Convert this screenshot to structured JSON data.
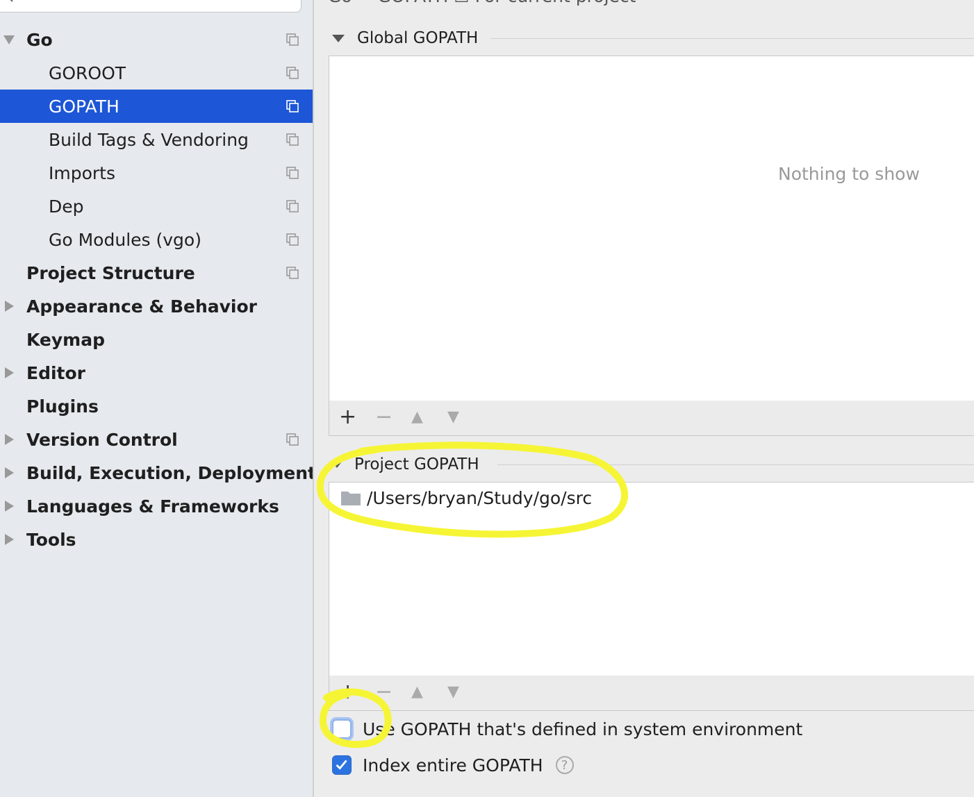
{
  "colors": {
    "selection": "#1d56d6",
    "highlight": "#f6f535",
    "checkbox_on": "#2b73e0"
  },
  "top_fragment": "Go  →  GOPATH        ☐ For current project",
  "sidebar": {
    "search_icon": "search-icon",
    "items": [
      {
        "label": "Go",
        "level": 0,
        "arrow": "down",
        "copy_icon": true
      },
      {
        "label": "GOROOT",
        "level": 1,
        "arrow": "none",
        "copy_icon": true
      },
      {
        "label": "GOPATH",
        "level": 1,
        "arrow": "none",
        "copy_icon": true,
        "selected": true
      },
      {
        "label": "Build Tags & Vendoring",
        "level": 1,
        "arrow": "none",
        "copy_icon": true
      },
      {
        "label": "Imports",
        "level": 1,
        "arrow": "none",
        "copy_icon": true
      },
      {
        "label": "Dep",
        "level": 1,
        "arrow": "none",
        "copy_icon": true
      },
      {
        "label": "Go Modules (vgo)",
        "level": 1,
        "arrow": "none",
        "copy_icon": true
      },
      {
        "label": "Project Structure",
        "level": 0,
        "arrow": "none",
        "copy_icon": true
      },
      {
        "label": "Appearance & Behavior",
        "level": 0,
        "arrow": "right",
        "copy_icon": false
      },
      {
        "label": "Keymap",
        "level": 0,
        "arrow": "none",
        "copy_icon": false
      },
      {
        "label": "Editor",
        "level": 0,
        "arrow": "right",
        "copy_icon": false
      },
      {
        "label": "Plugins",
        "level": 0,
        "arrow": "none",
        "copy_icon": false
      },
      {
        "label": "Version Control",
        "level": 0,
        "arrow": "right",
        "copy_icon": true
      },
      {
        "label": "Build, Execution, Deployment",
        "level": 0,
        "arrow": "right",
        "copy_icon": false
      },
      {
        "label": "Languages & Frameworks",
        "level": 0,
        "arrow": "right",
        "copy_icon": false
      },
      {
        "label": "Tools",
        "level": 0,
        "arrow": "right",
        "copy_icon": false
      }
    ]
  },
  "global_gopath": {
    "title": "Global GOPATH",
    "empty_text": "Nothing to show",
    "toolbar": [
      "+",
      "−",
      "▲",
      "▼"
    ]
  },
  "project_gopath": {
    "title": "Project GOPATH",
    "paths": [
      "/Users/bryan/Study/go/src"
    ],
    "toolbar": [
      "+",
      "−",
      "▲",
      "▼"
    ]
  },
  "options": {
    "use_system_gopath": {
      "label": "Use GOPATH that's defined in system environment",
      "checked": false
    },
    "index_entire_gopath": {
      "label": "Index entire GOPATH",
      "checked": true,
      "help_icon": "?"
    }
  }
}
